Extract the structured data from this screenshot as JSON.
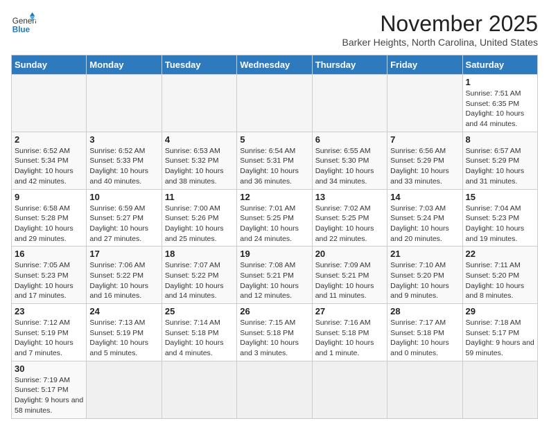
{
  "logo": {
    "general": "General",
    "blue": "Blue"
  },
  "header": {
    "month": "November 2025",
    "location": "Barker Heights, North Carolina, United States"
  },
  "days_of_week": [
    "Sunday",
    "Monday",
    "Tuesday",
    "Wednesday",
    "Thursday",
    "Friday",
    "Saturday"
  ],
  "weeks": [
    [
      {
        "day": "",
        "info": ""
      },
      {
        "day": "",
        "info": ""
      },
      {
        "day": "",
        "info": ""
      },
      {
        "day": "",
        "info": ""
      },
      {
        "day": "",
        "info": ""
      },
      {
        "day": "",
        "info": ""
      },
      {
        "day": "1",
        "info": "Sunrise: 7:51 AM\nSunset: 6:35 PM\nDaylight: 10 hours and 44 minutes."
      }
    ],
    [
      {
        "day": "2",
        "info": "Sunrise: 6:52 AM\nSunset: 5:34 PM\nDaylight: 10 hours and 42 minutes."
      },
      {
        "day": "3",
        "info": "Sunrise: 6:52 AM\nSunset: 5:33 PM\nDaylight: 10 hours and 40 minutes."
      },
      {
        "day": "4",
        "info": "Sunrise: 6:53 AM\nSunset: 5:32 PM\nDaylight: 10 hours and 38 minutes."
      },
      {
        "day": "5",
        "info": "Sunrise: 6:54 AM\nSunset: 5:31 PM\nDaylight: 10 hours and 36 minutes."
      },
      {
        "day": "6",
        "info": "Sunrise: 6:55 AM\nSunset: 5:30 PM\nDaylight: 10 hours and 34 minutes."
      },
      {
        "day": "7",
        "info": "Sunrise: 6:56 AM\nSunset: 5:29 PM\nDaylight: 10 hours and 33 minutes."
      },
      {
        "day": "8",
        "info": "Sunrise: 6:57 AM\nSunset: 5:29 PM\nDaylight: 10 hours and 31 minutes."
      }
    ],
    [
      {
        "day": "9",
        "info": "Sunrise: 6:58 AM\nSunset: 5:28 PM\nDaylight: 10 hours and 29 minutes."
      },
      {
        "day": "10",
        "info": "Sunrise: 6:59 AM\nSunset: 5:27 PM\nDaylight: 10 hours and 27 minutes."
      },
      {
        "day": "11",
        "info": "Sunrise: 7:00 AM\nSunset: 5:26 PM\nDaylight: 10 hours and 25 minutes."
      },
      {
        "day": "12",
        "info": "Sunrise: 7:01 AM\nSunset: 5:25 PM\nDaylight: 10 hours and 24 minutes."
      },
      {
        "day": "13",
        "info": "Sunrise: 7:02 AM\nSunset: 5:25 PM\nDaylight: 10 hours and 22 minutes."
      },
      {
        "day": "14",
        "info": "Sunrise: 7:03 AM\nSunset: 5:24 PM\nDaylight: 10 hours and 20 minutes."
      },
      {
        "day": "15",
        "info": "Sunrise: 7:04 AM\nSunset: 5:23 PM\nDaylight: 10 hours and 19 minutes."
      }
    ],
    [
      {
        "day": "16",
        "info": "Sunrise: 7:05 AM\nSunset: 5:23 PM\nDaylight: 10 hours and 17 minutes."
      },
      {
        "day": "17",
        "info": "Sunrise: 7:06 AM\nSunset: 5:22 PM\nDaylight: 10 hours and 16 minutes."
      },
      {
        "day": "18",
        "info": "Sunrise: 7:07 AM\nSunset: 5:22 PM\nDaylight: 10 hours and 14 minutes."
      },
      {
        "day": "19",
        "info": "Sunrise: 7:08 AM\nSunset: 5:21 PM\nDaylight: 10 hours and 12 minutes."
      },
      {
        "day": "20",
        "info": "Sunrise: 7:09 AM\nSunset: 5:21 PM\nDaylight: 10 hours and 11 minutes."
      },
      {
        "day": "21",
        "info": "Sunrise: 7:10 AM\nSunset: 5:20 PM\nDaylight: 10 hours and 9 minutes."
      },
      {
        "day": "22",
        "info": "Sunrise: 7:11 AM\nSunset: 5:20 PM\nDaylight: 10 hours and 8 minutes."
      }
    ],
    [
      {
        "day": "23",
        "info": "Sunrise: 7:12 AM\nSunset: 5:19 PM\nDaylight: 10 hours and 7 minutes."
      },
      {
        "day": "24",
        "info": "Sunrise: 7:13 AM\nSunset: 5:19 PM\nDaylight: 10 hours and 5 minutes."
      },
      {
        "day": "25",
        "info": "Sunrise: 7:14 AM\nSunset: 5:18 PM\nDaylight: 10 hours and 4 minutes."
      },
      {
        "day": "26",
        "info": "Sunrise: 7:15 AM\nSunset: 5:18 PM\nDaylight: 10 hours and 3 minutes."
      },
      {
        "day": "27",
        "info": "Sunrise: 7:16 AM\nSunset: 5:18 PM\nDaylight: 10 hours and 1 minute."
      },
      {
        "day": "28",
        "info": "Sunrise: 7:17 AM\nSunset: 5:18 PM\nDaylight: 10 hours and 0 minutes."
      },
      {
        "day": "29",
        "info": "Sunrise: 7:18 AM\nSunset: 5:17 PM\nDaylight: 9 hours and 59 minutes."
      }
    ],
    [
      {
        "day": "30",
        "info": "Sunrise: 7:19 AM\nSunset: 5:17 PM\nDaylight: 9 hours and 58 minutes."
      },
      {
        "day": "",
        "info": ""
      },
      {
        "day": "",
        "info": ""
      },
      {
        "day": "",
        "info": ""
      },
      {
        "day": "",
        "info": ""
      },
      {
        "day": "",
        "info": ""
      },
      {
        "day": "",
        "info": ""
      }
    ]
  ]
}
